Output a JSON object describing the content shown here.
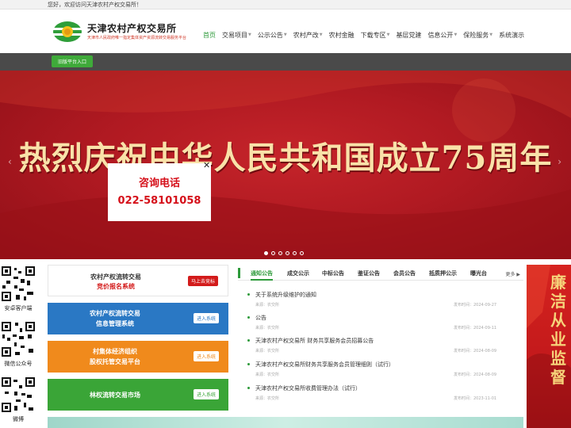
{
  "topbar": {
    "welcome": "您好，欢迎访问天津农村产权交易所！"
  },
  "header": {
    "site_title": "天津农村产权交易所",
    "site_subtitle": "天津市人民政府唯一指定集体资产资源流转交易服务平台"
  },
  "nav": {
    "items": [
      {
        "label": "首页",
        "active": true
      },
      {
        "label": "交易项目",
        "dropdown": true
      },
      {
        "label": "公示公告",
        "dropdown": true
      },
      {
        "label": "农村产改",
        "dropdown": true
      },
      {
        "label": "农村金融",
        "dropdown": false
      },
      {
        "label": "下载专区",
        "dropdown": true
      },
      {
        "label": "基层党建",
        "dropdown": false
      },
      {
        "label": "信息公开",
        "dropdown": true
      },
      {
        "label": "保险服务",
        "dropdown": true
      },
      {
        "label": "系统演示",
        "dropdown": false
      }
    ]
  },
  "old_platform_button": "旧版平台入口",
  "banner": {
    "headline": "热烈庆祝中华人民共和国成立75周年",
    "slide_count": 6,
    "active_slide": 1
  },
  "popup": {
    "close": "✕",
    "label": "咨询电话",
    "phone": "022-58101058"
  },
  "qr_codes": [
    {
      "label": "安卓客户端"
    },
    {
      "label": "微信公众号"
    },
    {
      "label": "微博"
    }
  ],
  "services": [
    {
      "line1": "农村产权流转交易",
      "line2": "竞价报名系统",
      "button": "马上去竞标"
    },
    {
      "line1": "农村产权流转交易",
      "line2": "信息管理系统",
      "button": "进入系统"
    },
    {
      "line1": "村集体经济组织",
      "line2": "股权托管交易平台",
      "button": "进入系统"
    },
    {
      "line1": "林权流转交易市场",
      "line2": "",
      "button": "进入系统"
    }
  ],
  "news": {
    "tabs": [
      "通知公告",
      "成交公示",
      "中标公告",
      "鉴证公告",
      "会员公告",
      "抵质押公示",
      "曝光台"
    ],
    "active_tab": 0,
    "more": "更多 ▶",
    "items": [
      {
        "title": "关于系统升级维护的通知",
        "source": "来源：农交所",
        "date": "发布时间：2024-09-27"
      },
      {
        "title": "公告",
        "source": "来源：农交所",
        "date": "发布时间：2024-09-11"
      },
      {
        "title": "天津农村产权交易所 财务共享服务会员招募公告",
        "source": "来源：农交所",
        "date": "发布时间：2024-08-09"
      },
      {
        "title": "天津农村产权交易所财务共享服务会员管理细则（试行）",
        "source": "来源：农交所",
        "date": "发布时间：2024-08-09"
      },
      {
        "title": "天津农村产权交易所收费管理办法（试行）",
        "source": "来源：农交所",
        "date": "发布时间：2023-11-01"
      }
    ]
  },
  "right_poster": {
    "text": "廉洁从业监督"
  },
  "colors": {
    "brand_green": "#2d9a3a",
    "banner_red": "#b11a22",
    "alert_red": "#d5101a"
  }
}
